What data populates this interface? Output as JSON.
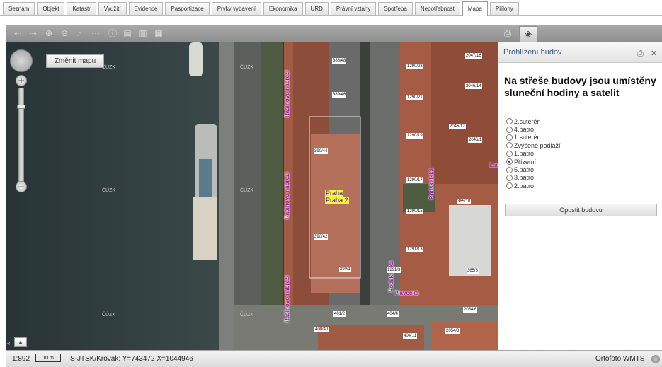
{
  "tabs": [
    {
      "label": "Seznam"
    },
    {
      "label": "Objekt"
    },
    {
      "label": "Katastr"
    },
    {
      "label": "Využití"
    },
    {
      "label": "Evidence"
    },
    {
      "label": "Pasportizace"
    },
    {
      "label": "Prvky vybavení"
    },
    {
      "label": "Ekonomika"
    },
    {
      "label": "URD"
    },
    {
      "label": "Právní vztahy"
    },
    {
      "label": "Spotřeba"
    },
    {
      "label": "Nepotřebnost"
    },
    {
      "label": "Mapa",
      "active": true
    },
    {
      "label": "Přílohy"
    }
  ],
  "toolbar": {
    "icons": [
      "arrow-left-icon",
      "arrow-right-icon",
      "zoom-in-icon",
      "zoom-out-icon",
      "zoom-full-icon",
      "measure-icon",
      "info-icon",
      "print-icon",
      "legend-icon",
      "export-icon"
    ],
    "right_icons": [
      "print-layer-icon",
      "layers-icon"
    ]
  },
  "map": {
    "change_map_label": "Změnit mapu",
    "watermark": "ČÚZK",
    "cast_labels": [
      "Praha",
      "Praha 2"
    ],
    "streets": {
      "rasinovo": "Rašínovo nábřeží",
      "podskalska": "Podskalská",
      "plavecka": "Plavecká",
      "lazarska": "Lac"
    },
    "parcel_labels": [
      "388/48",
      "389/46",
      "390/44",
      "390/42",
      "390/1",
      "1290/23",
      "1290/21",
      "1290/19",
      "1290/17",
      "1290/15",
      "1291/13",
      "1291/3",
      "2047/16",
      "2046/14",
      "2046/12",
      "2046/1",
      "365/10",
      "365/8",
      "2054/6",
      "2054/8",
      "401/2",
      "404/4",
      "404/11",
      "400/40"
    ]
  },
  "panel": {
    "title": "Prohlížení budov",
    "heading": "Na střeše budovy jsou umístěny sluneční hodiny a satelit",
    "floors": [
      {
        "label": "2.suterén",
        "selected": false
      },
      {
        "label": "4.patro",
        "selected": false
      },
      {
        "label": "1.suterén",
        "selected": false
      },
      {
        "label": "Zvýšené podlaží",
        "selected": false
      },
      {
        "label": "1.patro",
        "selected": false
      },
      {
        "label": "Přízemí",
        "selected": true
      },
      {
        "label": "5.patro",
        "selected": false
      },
      {
        "label": "3.patro",
        "selected": false
      },
      {
        "label": "2.patro",
        "selected": false
      }
    ],
    "leave_button": "Opustit budovu"
  },
  "status": {
    "scale": "1:892",
    "scale_bar": "10 m",
    "coords": "S-JTSK/Krovak: Y=743472 X=1044946",
    "layer": "Ortofoto WMTS"
  }
}
